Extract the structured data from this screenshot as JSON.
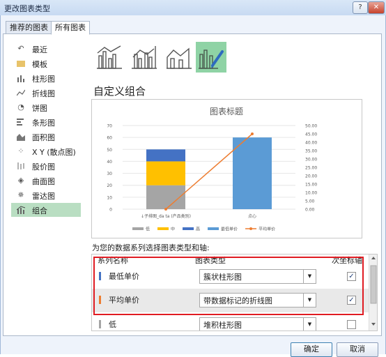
{
  "window": {
    "title": "更改图表类型",
    "help": "?",
    "close": "✕"
  },
  "tabs": [
    {
      "label": "推荐的图表"
    },
    {
      "label": "所有图表"
    }
  ],
  "sidebar": {
    "items": [
      {
        "label": "最近",
        "icon": "recent-icon"
      },
      {
        "label": "模板",
        "icon": "folder-icon"
      },
      {
        "label": "柱形图",
        "icon": "column-chart-icon"
      },
      {
        "label": "折线图",
        "icon": "line-chart-icon"
      },
      {
        "label": "饼图",
        "icon": "pie-chart-icon"
      },
      {
        "label": "条形图",
        "icon": "bar-chart-icon"
      },
      {
        "label": "面积图",
        "icon": "area-chart-icon"
      },
      {
        "label": "X Y (散点图)",
        "icon": "scatter-chart-icon"
      },
      {
        "label": "股价图",
        "icon": "stock-chart-icon"
      },
      {
        "label": "曲面图",
        "icon": "surface-chart-icon"
      },
      {
        "label": "雷达图",
        "icon": "radar-chart-icon"
      },
      {
        "label": "组合",
        "icon": "combo-chart-icon"
      }
    ],
    "selected": "组合"
  },
  "section_title": "自定义组合",
  "chart_data": {
    "type": "bar",
    "title": "图表标题",
    "categories": [
      "↓子排图_da ta (产品类别)",
      "点心"
    ],
    "series": [
      {
        "name": "低",
        "type": "stacked-bar",
        "color": "#a5a5a5",
        "values": [
          20,
          0
        ]
      },
      {
        "name": "中",
        "type": "stacked-bar",
        "color": "#ffc000",
        "values": [
          20,
          0
        ]
      },
      {
        "name": "高",
        "type": "stacked-bar",
        "color": "#4472c4",
        "values": [
          10,
          0
        ]
      },
      {
        "name": "最低单价",
        "type": "clustered-bar",
        "color": "#5b9bd5",
        "values": [
          0,
          60
        ]
      },
      {
        "name": "平均单价",
        "type": "line",
        "axis": "secondary",
        "color": "#ed7d31",
        "values": [
          0,
          45
        ]
      }
    ],
    "y_ticks": [
      "0",
      "10",
      "20",
      "30",
      "40",
      "50",
      "60",
      "70"
    ],
    "y2_ticks": [
      "0.00",
      "5.00",
      "10.00",
      "15.00",
      "20.00",
      "25.00",
      "30.00",
      "35.00",
      "40.00",
      "45.00",
      "50.00"
    ],
    "ylim": [
      0,
      70
    ],
    "y2lim": [
      0,
      50
    ],
    "legend_position": "bottom"
  },
  "series_table": {
    "prompt": "为您的数据系列选择图表类型和轴:",
    "headers": {
      "name": "系列名称",
      "type": "图表类型",
      "secondary": "次坐标轴"
    },
    "rows": [
      {
        "name": "最低单价",
        "type": "簇状柱形图",
        "secondary": true,
        "color": "#4472c4"
      },
      {
        "name": "平均单价",
        "type": "带数据标记的折线图",
        "secondary": true,
        "color": "#ed7d31"
      },
      {
        "name": "低",
        "type": "堆积柱形图",
        "secondary": false,
        "color": "#a5a5a5"
      }
    ]
  },
  "buttons": {
    "ok": "确定",
    "cancel": "取消"
  },
  "colors": {
    "selected_bg": "#b9dec2",
    "highlight_border": "#e01b22"
  }
}
